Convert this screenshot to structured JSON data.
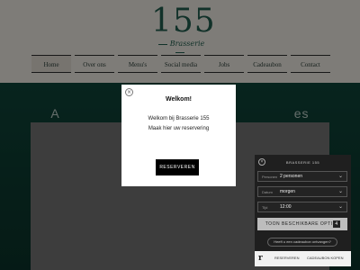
{
  "logo": {
    "number": "155",
    "subtitle": "Brasserie"
  },
  "nav": {
    "items": [
      "Home",
      "Over ons",
      "Menu's",
      "Social media",
      "Jobs",
      "Cadeaubon",
      "Contact"
    ],
    "active_index": 0
  },
  "hero": {
    "title_left": "A",
    "title_right": "es"
  },
  "modal": {
    "close_symbol": "×",
    "title": "Welkom!",
    "line1": "Welkom bij Brasserie 155",
    "line2": "Maak hier uw reservering",
    "button_label": "RESERVEREN"
  },
  "widget": {
    "close_symbol": "×",
    "title": "BRASSERIE 155",
    "fields": [
      {
        "label": "Personen",
        "value": "2 personen"
      },
      {
        "label": "Datum",
        "value": "morgen"
      },
      {
        "label": "Tijd",
        "value": "12:00"
      }
    ],
    "chevron_symbol": "⌄",
    "check_button": "TOON BESCHIKBARE OPTIES",
    "check_badge": "4",
    "voucher_link": "Heeft u een cadeaubon ontvangen?",
    "footer_logo": "r",
    "footer_tab_reserve": "RESERVEREN",
    "footer_tab_voucher": "CADEAUBON KOPEN"
  },
  "colors": {
    "accent": "#1f5a4c",
    "header_bg": "#e6e2da",
    "hero_bg": "#0e4237",
    "widget_bg": "#1f1f1f"
  }
}
